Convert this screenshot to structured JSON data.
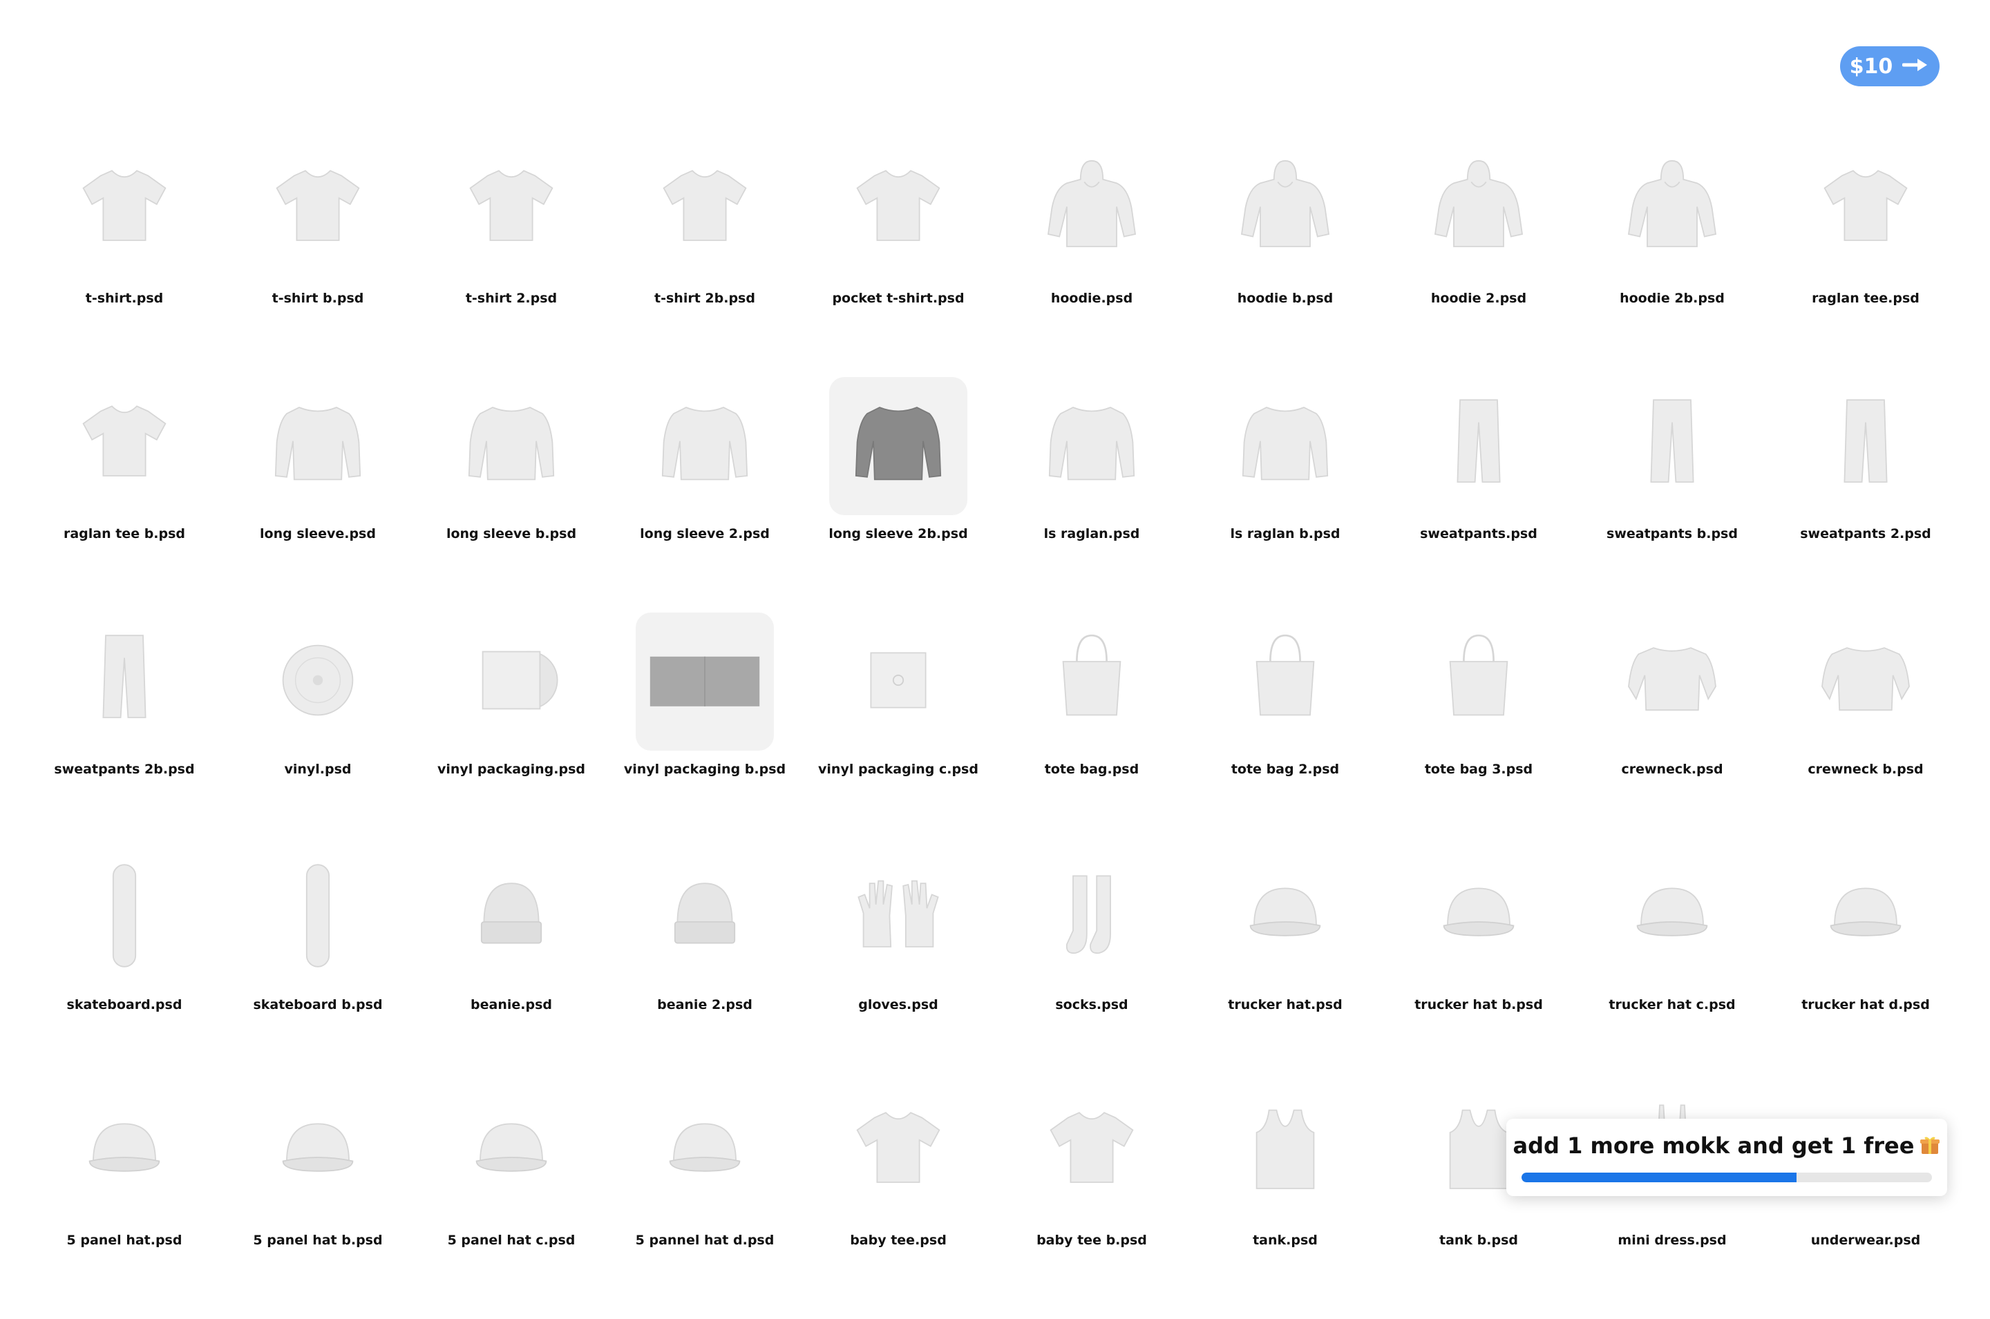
{
  "header": {
    "price_label": "$10",
    "accent_color": "#5e9ef2"
  },
  "items": [
    {
      "label": "t-shirt.psd",
      "icon": "tshirt-icon"
    },
    {
      "label": "t-shirt b.psd",
      "icon": "tshirt-icon"
    },
    {
      "label": "t-shirt 2.psd",
      "icon": "tshirt-icon"
    },
    {
      "label": "t-shirt 2b.psd",
      "icon": "tshirt-icon"
    },
    {
      "label": "pocket t-shirt.psd",
      "icon": "tshirt-icon"
    },
    {
      "label": "hoodie.psd",
      "icon": "hoodie-icon"
    },
    {
      "label": "hoodie b.psd",
      "icon": "hoodie-icon"
    },
    {
      "label": "hoodie 2.psd",
      "icon": "hoodie-icon"
    },
    {
      "label": "hoodie 2b.psd",
      "icon": "hoodie-icon"
    },
    {
      "label": "raglan tee.psd",
      "icon": "tshirt-icon"
    },
    {
      "label": "raglan tee b.psd",
      "icon": "tshirt-icon"
    },
    {
      "label": "long sleeve.psd",
      "icon": "long-sleeve-icon"
    },
    {
      "label": "long sleeve b.psd",
      "icon": "long-sleeve-icon"
    },
    {
      "label": "long sleeve 2.psd",
      "icon": "long-sleeve-icon"
    },
    {
      "label": "long sleeve 2b.psd",
      "icon": "long-sleeve-icon",
      "highlighted": true
    },
    {
      "label": "ls raglan.psd",
      "icon": "long-sleeve-icon"
    },
    {
      "label": "ls raglan b.psd",
      "icon": "long-sleeve-icon"
    },
    {
      "label": "sweatpants.psd",
      "icon": "pants-icon"
    },
    {
      "label": "sweatpants b.psd",
      "icon": "pants-icon"
    },
    {
      "label": "sweatpants 2.psd",
      "icon": "pants-icon"
    },
    {
      "label": "sweatpants 2b.psd",
      "icon": "pants-icon"
    },
    {
      "label": "vinyl.psd",
      "icon": "vinyl-icon"
    },
    {
      "label": "vinyl packaging.psd",
      "icon": "vinyl-packaging-icon"
    },
    {
      "label": "vinyl packaging b.psd",
      "icon": "vinyl-gatefold-icon",
      "highlighted": true
    },
    {
      "label": "vinyl packaging c.psd",
      "icon": "vinyl-sleeve-icon"
    },
    {
      "label": "tote bag.psd",
      "icon": "tote-bag-icon"
    },
    {
      "label": "tote bag 2.psd",
      "icon": "tote-bag-icon"
    },
    {
      "label": "tote bag 3.psd",
      "icon": "tote-bag-icon"
    },
    {
      "label": "crewneck.psd",
      "icon": "crewneck-icon"
    },
    {
      "label": "crewneck b.psd",
      "icon": "crewneck-icon"
    },
    {
      "label": "skateboard.psd",
      "icon": "skateboard-icon"
    },
    {
      "label": "skateboard b.psd",
      "icon": "skateboard-icon"
    },
    {
      "label": "beanie.psd",
      "icon": "beanie-icon"
    },
    {
      "label": "beanie 2.psd",
      "icon": "beanie-icon"
    },
    {
      "label": "gloves.psd",
      "icon": "gloves-icon"
    },
    {
      "label": "socks.psd",
      "icon": "socks-icon"
    },
    {
      "label": "trucker hat.psd",
      "icon": "cap-icon"
    },
    {
      "label": "trucker hat b.psd",
      "icon": "cap-icon"
    },
    {
      "label": "trucker hat c.psd",
      "icon": "cap-icon"
    },
    {
      "label": "trucker hat d.psd",
      "icon": "cap-icon"
    },
    {
      "label": "5 panel hat.psd",
      "icon": "cap-icon"
    },
    {
      "label": "5 panel hat b.psd",
      "icon": "cap-icon"
    },
    {
      "label": "5 panel hat c.psd",
      "icon": "cap-icon"
    },
    {
      "label": "5 pannel hat d.psd",
      "icon": "cap-icon"
    },
    {
      "label": "baby tee.psd",
      "icon": "tshirt-icon"
    },
    {
      "label": "baby tee b.psd",
      "icon": "tshirt-icon"
    },
    {
      "label": "tank.psd",
      "icon": "tank-icon"
    },
    {
      "label": "tank b.psd",
      "icon": "tank-icon"
    },
    {
      "label": "mini dress.psd",
      "icon": "dress-icon"
    },
    {
      "label": "underwear.psd",
      "icon": "underwear-icon"
    }
  ],
  "promo": {
    "message": "add 1 more mokk and get 1 free",
    "icon": "gift-icon",
    "progress_percent": 67,
    "progress_color": "#1a75e8"
  }
}
